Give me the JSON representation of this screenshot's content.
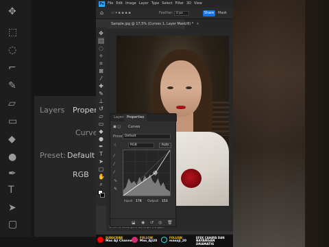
{
  "app": {
    "logo": "Ps"
  },
  "menubar": {
    "items": [
      "File",
      "Edit",
      "Image",
      "Layer",
      "Type",
      "Select",
      "Filter",
      "3D",
      "View"
    ]
  },
  "options": {
    "feather_label": "Feather:",
    "feather_value": "0 px",
    "share": "Share",
    "mask": "Mask"
  },
  "document": {
    "tab_title": "Sample.jpg @ 17,5% (Curves 1, Layer Mask/8) *",
    "close": "×"
  },
  "statusbar": {
    "text": "17,37%   1045 px x 1570 px (72 ppi)"
  },
  "properties": {
    "tab_layers": "Layers",
    "tab_properties": "Properties",
    "header": "Curves",
    "preset_label": "Preset:",
    "preset_value": "Default",
    "channel": "RGB",
    "auto_label": "Auto",
    "input_label": "Input:",
    "input_value": "178",
    "output_label": "Output:",
    "output_value": "153"
  },
  "background_left": {
    "layers_label": "Layers",
    "properties_label": "Proper",
    "curves_label": "Curve",
    "preset_label": "Preset:",
    "preset_value": "Default",
    "channel": "RGB"
  },
  "banner": [
    {
      "label": "SUBSCRIBE",
      "value": "Mas Aji Channel",
      "color": "#ff0000"
    },
    {
      "label": "FOLLOW",
      "value": "Mas_Aji20",
      "color": "#d62976"
    },
    {
      "label": "FOLLOW",
      "value": "masaji_20",
      "color": "#25f4ee"
    },
    {
      "label": "EFEK CAHAYA DAN",
      "value": "BAYANGAN DRAMATIS",
      "color": "#ffd100"
    }
  ],
  "colors": {
    "accent": "#31a8ff",
    "share": "#1473e6",
    "curve": "#ffffff",
    "lips": "#a1141c"
  }
}
